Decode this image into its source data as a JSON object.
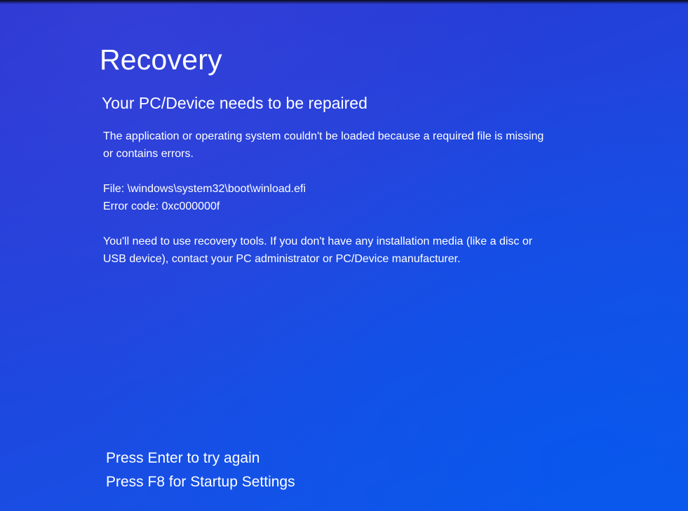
{
  "title": "Recovery",
  "subtitle": "Your PC/Device needs to be repaired",
  "description": {
    "line1": "The application or operating system couldn't be loaded because a required file is missing",
    "line2": "or contains errors."
  },
  "error": {
    "file_line": "File: \\windows\\system32\\boot\\winload.efi",
    "code_line": "Error code: 0xc000000f"
  },
  "instructions": {
    "line1": "You'll need to use recovery tools. If you don't have any installation media (like a disc or",
    "line2": "USB device), contact your PC administrator or PC/Device manufacturer."
  },
  "actions": {
    "enter": "Press Enter to try again",
    "f8": "Press F8 for Startup Settings"
  },
  "colors": {
    "background": "#1a3fd6",
    "text": "#ffffff"
  }
}
